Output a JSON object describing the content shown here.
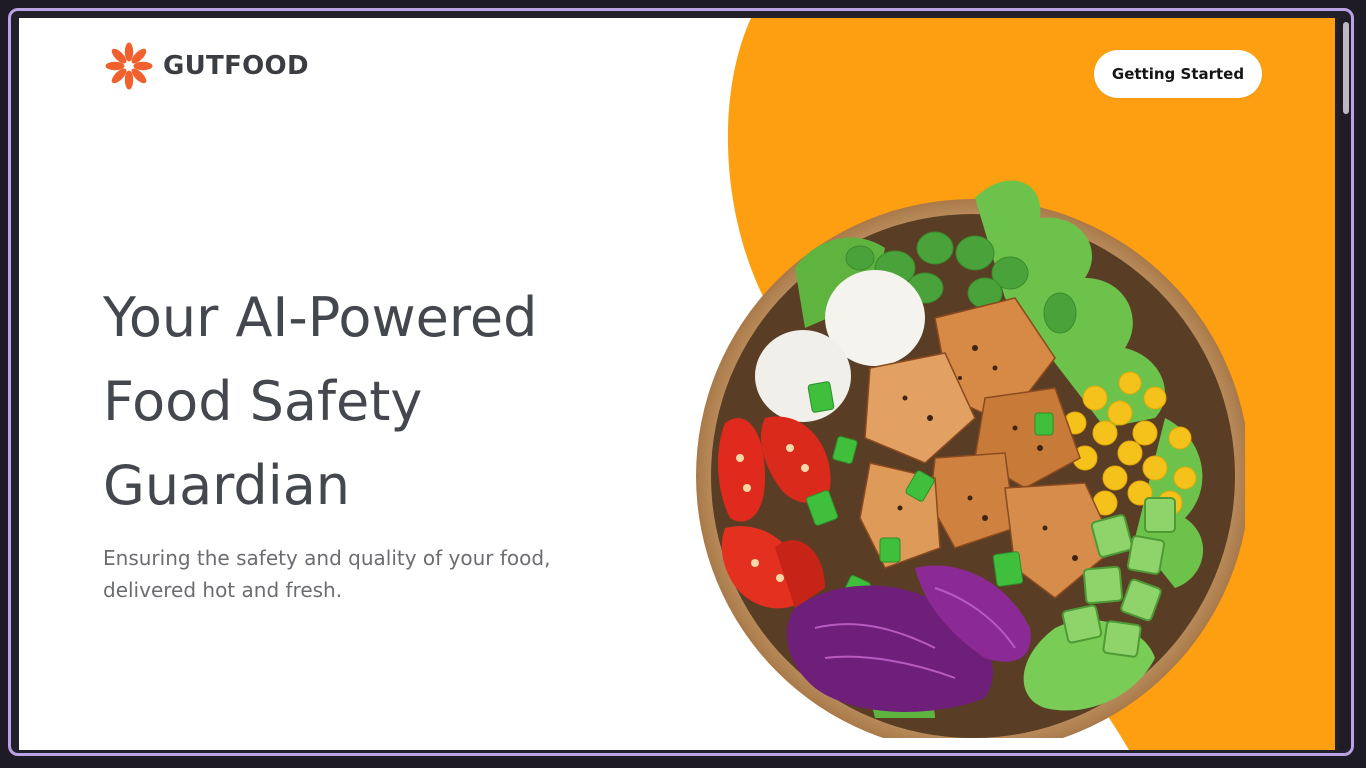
{
  "brand": {
    "name": "GUTFOOD",
    "icon": "sunburst-flower-icon",
    "icon_color": "#f0612e"
  },
  "header": {
    "cta_label": "Getting Started"
  },
  "hero": {
    "title_line1": "Your AI-Powered",
    "title_line2": "Food Safety",
    "title_line3": "Guardian",
    "subtitle_line1": "Ensuring the safety and quality of your food,",
    "subtitle_line2": "delivered hot and fresh."
  },
  "image": {
    "subject": "salad-bowl-image"
  },
  "colors": {
    "accent_orange": "#fd9f10",
    "title_text": "#44474d",
    "subtitle_text": "#6b6d72",
    "frame_border": "#b9a2e6"
  }
}
